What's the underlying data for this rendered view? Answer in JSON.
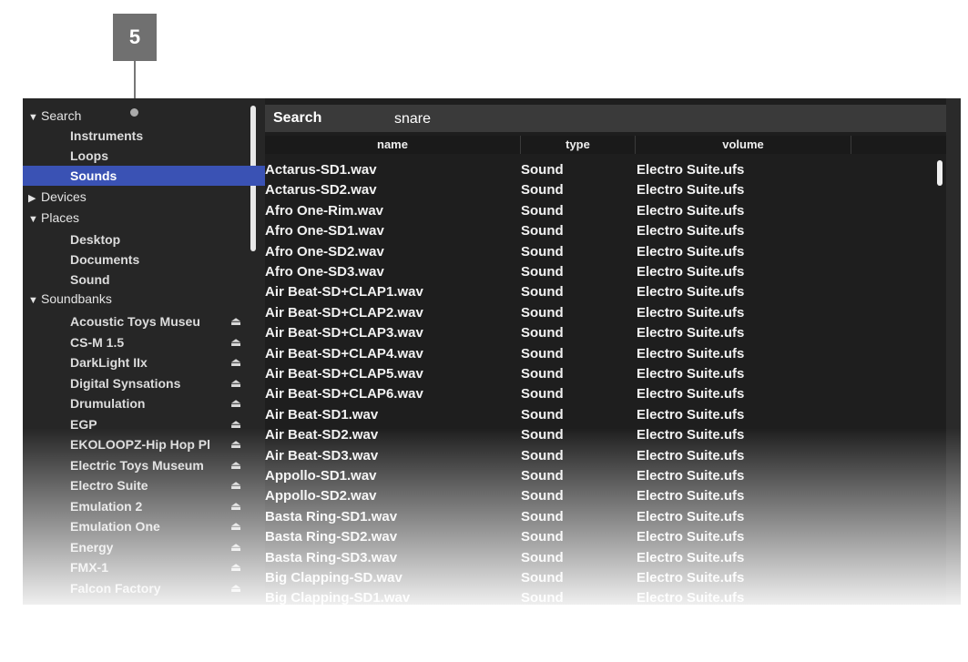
{
  "callout": {
    "number": "5"
  },
  "sidebar": {
    "search": {
      "label": "Search",
      "items": [
        {
          "label": "Instruments"
        },
        {
          "label": "Loops"
        },
        {
          "label": "Sounds",
          "selected": true
        }
      ]
    },
    "devices": {
      "label": "Devices"
    },
    "places": {
      "label": "Places",
      "items": [
        {
          "label": "Desktop"
        },
        {
          "label": "Documents"
        },
        {
          "label": "Sound"
        }
      ]
    },
    "soundbanks": {
      "label": "Soundbanks",
      "items": [
        {
          "label": "Acoustic Toys Museu"
        },
        {
          "label": "CS-M 1.5"
        },
        {
          "label": "DarkLight IIx"
        },
        {
          "label": "Digital Synsations"
        },
        {
          "label": "Drumulation"
        },
        {
          "label": "EGP"
        },
        {
          "label": "EKOLOOPZ-Hip Hop Pl"
        },
        {
          "label": "Electric Toys Museum"
        },
        {
          "label": "Electro Suite"
        },
        {
          "label": "Emulation 2"
        },
        {
          "label": "Emulation One"
        },
        {
          "label": "Energy"
        },
        {
          "label": "FMX-1"
        },
        {
          "label": "Falcon Factory"
        }
      ]
    },
    "eject_icon": "⏏"
  },
  "search": {
    "label": "Search",
    "value": "snare"
  },
  "table": {
    "columns": [
      "name",
      "type",
      "volume"
    ],
    "rows": [
      [
        "Actarus-SD1.wav",
        "Sound",
        "Electro Suite.ufs"
      ],
      [
        "Actarus-SD2.wav",
        "Sound",
        "Electro Suite.ufs"
      ],
      [
        "Afro One-Rim.wav",
        "Sound",
        "Electro Suite.ufs"
      ],
      [
        "Afro One-SD1.wav",
        "Sound",
        "Electro Suite.ufs"
      ],
      [
        "Afro One-SD2.wav",
        "Sound",
        "Electro Suite.ufs"
      ],
      [
        "Afro One-SD3.wav",
        "Sound",
        "Electro Suite.ufs"
      ],
      [
        "Air Beat-SD+CLAP1.wav",
        "Sound",
        "Electro Suite.ufs"
      ],
      [
        "Air Beat-SD+CLAP2.wav",
        "Sound",
        "Electro Suite.ufs"
      ],
      [
        "Air Beat-SD+CLAP3.wav",
        "Sound",
        "Electro Suite.ufs"
      ],
      [
        "Air Beat-SD+CLAP4.wav",
        "Sound",
        "Electro Suite.ufs"
      ],
      [
        "Air Beat-SD+CLAP5.wav",
        "Sound",
        "Electro Suite.ufs"
      ],
      [
        "Air Beat-SD+CLAP6.wav",
        "Sound",
        "Electro Suite.ufs"
      ],
      [
        "Air Beat-SD1.wav",
        "Sound",
        "Electro Suite.ufs"
      ],
      [
        "Air Beat-SD2.wav",
        "Sound",
        "Electro Suite.ufs"
      ],
      [
        "Air Beat-SD3.wav",
        "Sound",
        "Electro Suite.ufs"
      ],
      [
        "Appollo-SD1.wav",
        "Sound",
        "Electro Suite.ufs"
      ],
      [
        "Appollo-SD2.wav",
        "Sound",
        "Electro Suite.ufs"
      ],
      [
        "Basta Ring-SD1.wav",
        "Sound",
        "Electro Suite.ufs"
      ],
      [
        "Basta Ring-SD2.wav",
        "Sound",
        "Electro Suite.ufs"
      ],
      [
        "Basta Ring-SD3.wav",
        "Sound",
        "Electro Suite.ufs"
      ],
      [
        "Big Clapping-SD.wav",
        "Sound",
        "Electro Suite.ufs"
      ],
      [
        "Big Clapping-SD1.wav",
        "Sound",
        "Electro Suite.ufs"
      ]
    ]
  }
}
